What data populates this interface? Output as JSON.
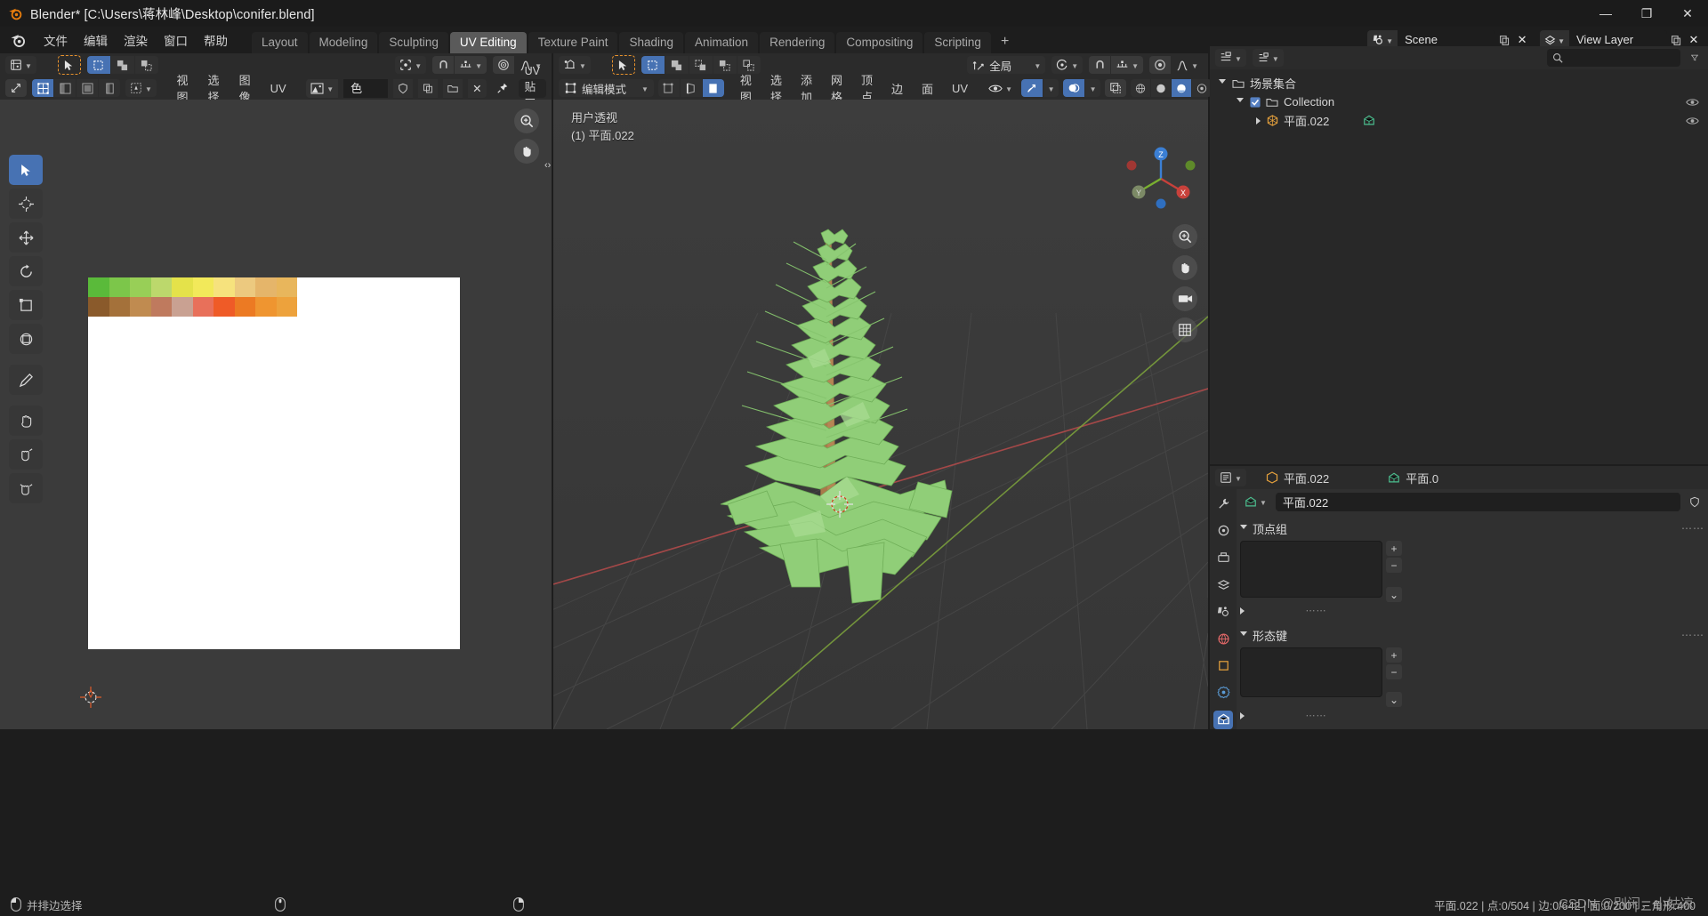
{
  "window": {
    "title": "Blender* [C:\\Users\\蒋林峰\\Desktop\\conifer.blend]",
    "controls": {
      "minimize": "—",
      "maximize": "❐",
      "close": "✕"
    }
  },
  "topbar": {
    "menus": [
      "文件",
      "编辑",
      "渲染",
      "窗口",
      "帮助"
    ],
    "workspaces": [
      "Layout",
      "Modeling",
      "Sculpting",
      "UV Editing",
      "Texture Paint",
      "Shading",
      "Animation",
      "Rendering",
      "Compositing",
      "Scripting"
    ],
    "active_workspace": "UV Editing",
    "add_workspace": "+",
    "scene_name": "Scene",
    "view_layer_name": "View Layer"
  },
  "uv_editor": {
    "row1": {
      "editor_type": "uv-editor-icon",
      "tools": [
        "tweak-tool",
        "select-box",
        "select-circle",
        "select-lasso"
      ],
      "pivot": "pivot-icon",
      "snap": "snap-magnet-icon",
      "snap_mode": "snap-increment-icon",
      "proportional": "proportional-edit-icon",
      "falloff": "smooth-falloff-icon"
    },
    "row2": {
      "uv_sync": "uv-sync-icon",
      "select_modes": [
        "vertex",
        "edge",
        "face",
        "island"
      ],
      "sticky": "sticky-selection-icon",
      "menus": [
        "视图",
        "选择",
        "图像",
        "UV"
      ],
      "image_browse": "image-browse-icon",
      "image_name": "色卡.jpg",
      "fake_user": "shield-icon",
      "new_copy": "copy-icon",
      "open_image": "folder-icon",
      "unlink": "x-icon",
      "pin": "pin-icon",
      "uv_label": "UV 贴图"
    },
    "toolbar": [
      "tweak-tool",
      "cursor-tool",
      "move-tool",
      "rotate-tool",
      "scale-tool",
      "transform-tool",
      "annotate-tool",
      "grab-tool",
      "relax-tool",
      "pinch-tool"
    ],
    "active_tool_index": 0,
    "gizmos": [
      "zoom-gizmo",
      "pan-gizmo"
    ],
    "color_card_row1": [
      "#5aba3a",
      "#7cc64a",
      "#98cf57",
      "#bcd86c",
      "#e4e24a",
      "#f2e95a",
      "#f6e27d",
      "#ecc97f",
      "#e5b56a",
      "#e8b65c"
    ],
    "color_card_row2": [
      "#8a5a2b",
      "#a4713a",
      "#c08b50",
      "#bf7a5e",
      "#c9a192",
      "#e8705a",
      "#ef5b27",
      "#ec7a23",
      "#ef9530",
      "#eda23c"
    ]
  },
  "view3d": {
    "row1": {
      "editor_type": "3d-viewport-icon",
      "tools": [
        "tweak-tool",
        "select-box",
        "select-circle",
        "select-lasso",
        "select-extend"
      ],
      "transform_orientation_icon": "orientation-icon",
      "transform_orientation": "全局",
      "pivot": "pivot-point-icon",
      "snap": "snap-magnet-icon",
      "snap_mode": "snap-increment-icon",
      "proportional": "proportional-edit-icon",
      "falloff": "smooth-falloff-icon"
    },
    "row2": {
      "mode_icon": "edit-mode-icon",
      "mode": "编辑模式",
      "select_modes": [
        "vertex",
        "edge",
        "face"
      ],
      "active_select_mode": "face",
      "menus": [
        "视图",
        "选择",
        "添加",
        "网格",
        "顶点",
        "边",
        "面",
        "UV"
      ],
      "visibility": "eye-icon",
      "gizmo": "gizmo-icon",
      "overlays": "overlays-icon",
      "xray": "xray-icon",
      "shading": [
        "wireframe",
        "solid",
        "material-preview",
        "rendered"
      ],
      "active_shading": "material-preview"
    },
    "overlay_text": {
      "perspective": "用户透视",
      "object": "(1) 平面.022"
    },
    "gizmo_axes": {
      "x": "X",
      "y": "Y",
      "z": "Z"
    },
    "nav_tools": [
      "zoom-gizmo",
      "pan-gizmo",
      "camera-gizmo",
      "ortho-persp-gizmo"
    ]
  },
  "outliner": {
    "display_mode": "view-layer-icon",
    "filter_icon": "filter-icon",
    "search_placeholder": "",
    "search_icon": "search-icon",
    "items": [
      {
        "label": "场景集合",
        "indent": 0,
        "icon": "collection-icon",
        "expanded": true,
        "selected": false,
        "eye": true,
        "checkbox": false
      },
      {
        "label": "Collection",
        "indent": 1,
        "icon": "collection-icon",
        "expanded": true,
        "selected": false,
        "eye": true,
        "checkbox": true
      },
      {
        "label": "平面.022",
        "indent": 2,
        "icon": "mesh-object-icon",
        "expanded": false,
        "selected": false,
        "eye": true,
        "checkbox": false,
        "data_icon": "mesh-data-icon"
      }
    ]
  },
  "properties": {
    "breadcrumb_editor_icon": "properties-editor-icon",
    "breadcrumb_object_icon": "object-icon",
    "breadcrumb_object": "平面.022",
    "breadcrumb_data_icon": "mesh-data-icon",
    "breadcrumb_data": "平面.0",
    "tabs": [
      "tool-icon",
      "render-icon",
      "output-icon",
      "view-layer-icon",
      "scene-icon",
      "world-icon",
      "object-icon",
      "modifier-icon",
      "data-icon"
    ],
    "active_tab": "data-icon",
    "object_data_icon": "mesh-data-icon",
    "object_data_name": "平面.022",
    "shield_icon": "shield-icon",
    "panels": [
      {
        "title": "顶点组",
        "expanded": true,
        "side_buttons": [
          "+",
          "−",
          "⌄"
        ]
      },
      {
        "title": "形态键",
        "expanded": true,
        "side_buttons": [
          "+",
          "−",
          "⌄"
        ]
      }
    ]
  },
  "statusbar": {
    "left": [
      {
        "icon": "mouse-left-icon",
        "label": "并排边选择"
      },
      {
        "icon": "mouse-middle-icon",
        "label": ""
      },
      {
        "icon": "mouse-right-icon",
        "label": ""
      }
    ],
    "stats": "平面.022 | 点:0/504 | 边:0/642 | 面:0/200 | 三角形:400",
    "watermark": "CSDN @别闲，小姑凉"
  },
  "colors": {
    "accent": "#4772b3",
    "header": "#2b2b2b",
    "panel": "#303030",
    "viewport": "#393939",
    "outliner": "#282828",
    "titlebar": "#1b1b1b",
    "axis_x": "#cc3333",
    "axis_y": "#8ec63f",
    "axis_z": "#2f7fd4",
    "foliage": "#8fce7a",
    "trunk": "#a9794a"
  }
}
